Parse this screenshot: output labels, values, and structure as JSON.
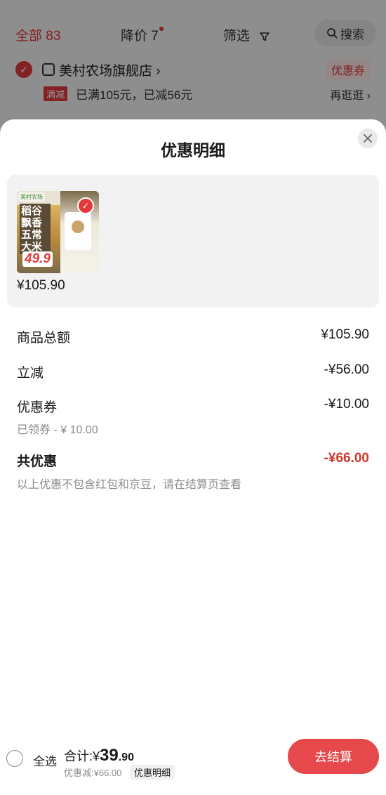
{
  "background": {
    "tabs": {
      "all": "全部 83",
      "price_drop": "降价 7",
      "filter": "筛选",
      "search": "搜索"
    },
    "store": {
      "name": "美村农场旗舰店 ›",
      "coupon_tag": "优惠券"
    },
    "promo": {
      "badge": "满减",
      "text": "已满105元，已减56元",
      "more": "再逛逛 ›"
    }
  },
  "sheet": {
    "title": "优惠明细",
    "product": {
      "logo_text": "美村农场",
      "package_text": "稻谷飘香五常大米",
      "package_price": "49.9",
      "price": "¥105.90"
    },
    "rows": {
      "total_label": "商品总额",
      "total_value": "¥105.90",
      "instant_label": "立减",
      "instant_value": "-¥56.00",
      "coupon_label": "优惠券",
      "coupon_value": "-¥10.00",
      "coupon_sub": "已领券 - ¥ 10.00",
      "sum_label": "共优惠",
      "sum_value": "-¥66.00",
      "note": "以上优惠不包含红包和京豆，请在结算页查看"
    }
  },
  "bottom": {
    "select_all": "全选",
    "total_prefix": "合计:¥",
    "total_int": "39",
    "total_dec": ".90",
    "discount": "优惠减:¥66.00",
    "detail_link": "优惠明细",
    "checkout": "去结算"
  },
  "colors": {
    "accent_red": "#e4393c",
    "discount_red": "#c8392b"
  }
}
